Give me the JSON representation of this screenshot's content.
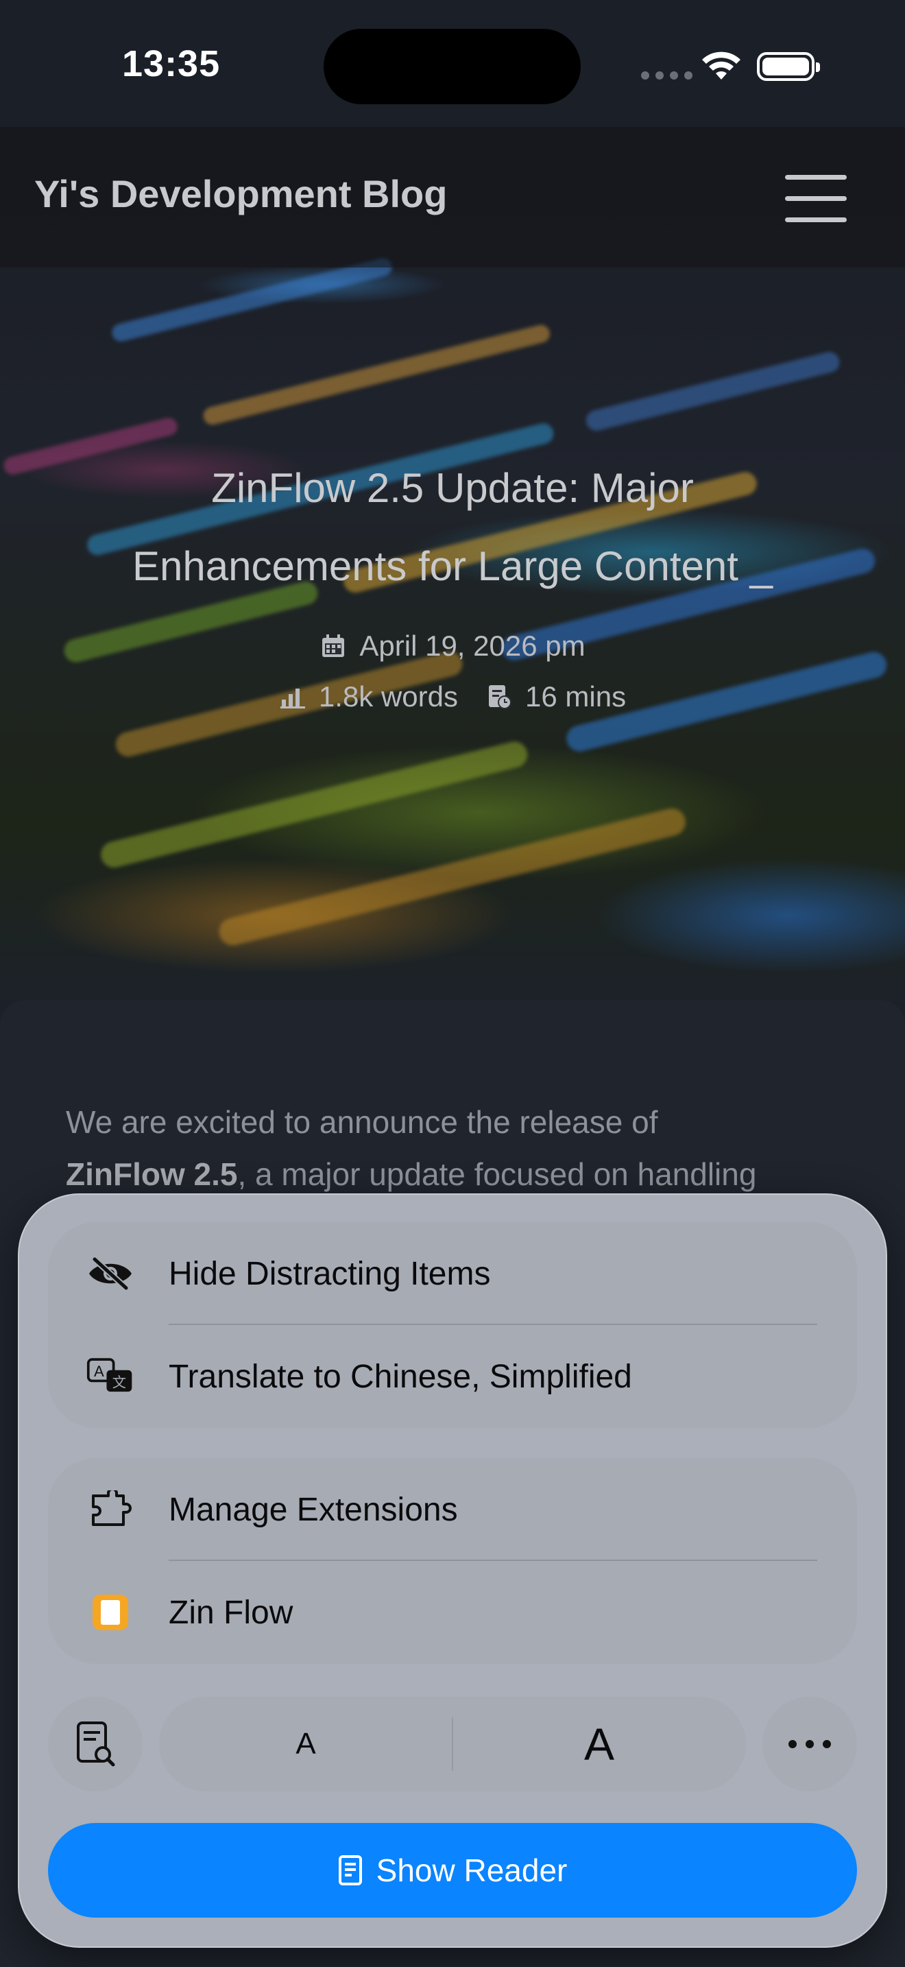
{
  "status_bar": {
    "time": "13:35"
  },
  "header": {
    "site_title": "Yi's Development Blog"
  },
  "post": {
    "title_line1": "ZinFlow 2.5 Update: Major",
    "title_line2": "Enhancements for Large Content _",
    "date": "April 19, 2026 pm",
    "words": "1.8k words",
    "read_time": "16 mins"
  },
  "article": {
    "intro_before": "We are excited to announce the release of",
    "intro_bold": "ZinFlow 2.5",
    "intro_after": ", a major update focused on handling"
  },
  "menu": {
    "group1": [
      {
        "label": "Hide Distracting Items",
        "icon": "eye-slash-icon"
      },
      {
        "label": "Translate to Chinese, Simplified",
        "icon": "translate-icon"
      }
    ],
    "group2": [
      {
        "label": "Manage Extensions",
        "icon": "extension-icon"
      },
      {
        "label": "Zin Flow",
        "icon": "zinflow-app-icon"
      }
    ],
    "font_small": "A",
    "font_large": "A",
    "show_reader": "Show Reader"
  },
  "colors": {
    "accent": "#0a84ff",
    "sheet": "#b0b5bf",
    "background": "#1c2029"
  }
}
